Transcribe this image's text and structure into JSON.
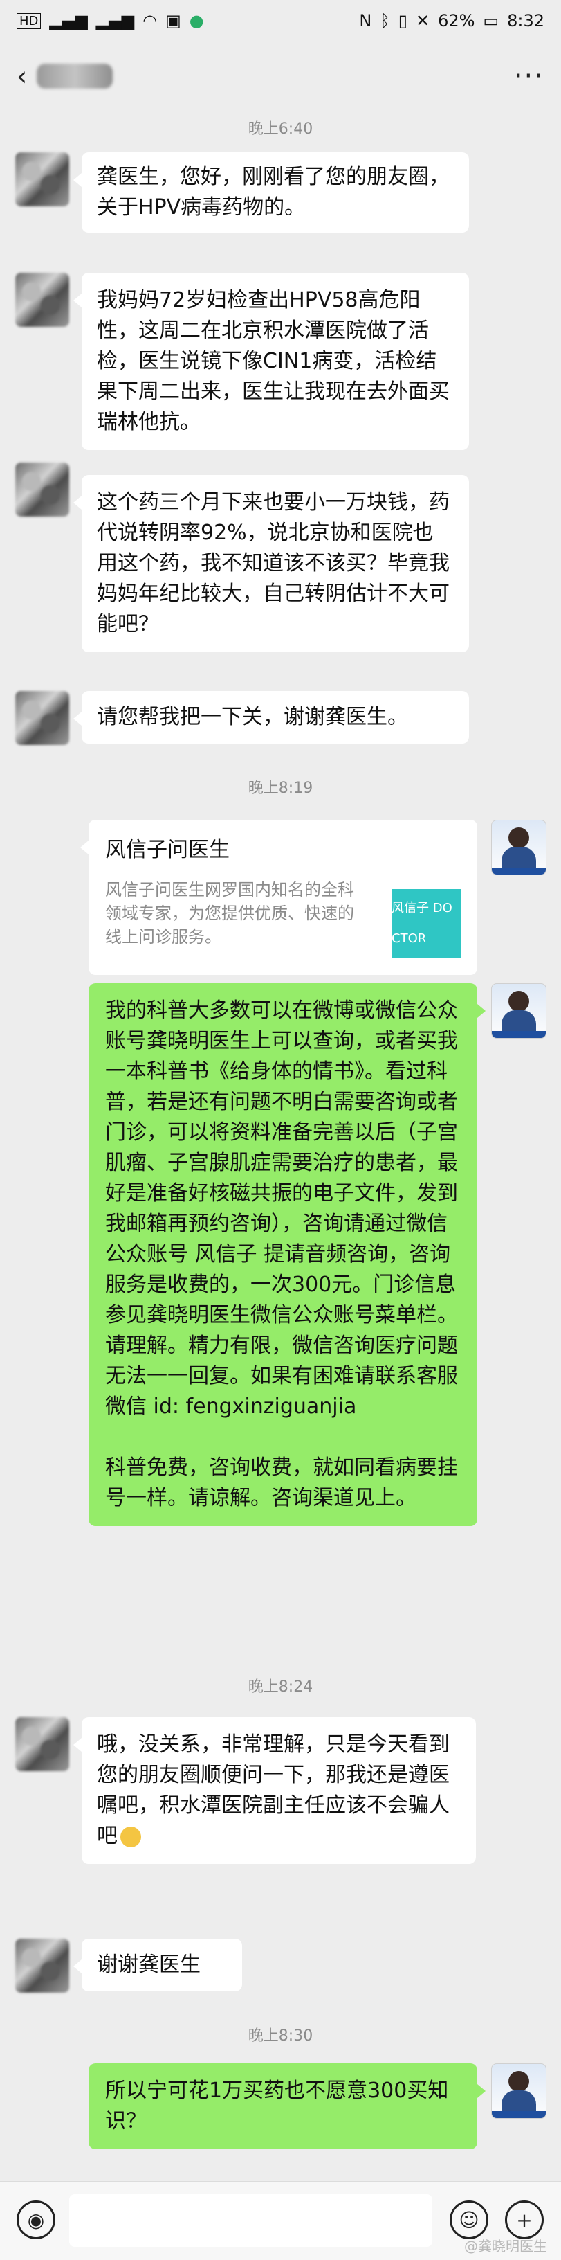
{
  "status_bar": {
    "left_icons": [
      "hd-icon",
      "signal-icon",
      "signal-icon",
      "wifi-icon",
      "notification-icon",
      "wechat-icon"
    ],
    "right_icons": [
      "nfc-icon",
      "bluetooth-icon",
      "vibrate-icon",
      "mute-icon"
    ],
    "battery": "62%",
    "time": "8:32"
  },
  "nav": {
    "back_glyph": "‹",
    "more_glyph": "···"
  },
  "timestamps": {
    "t1": "晚上6:40",
    "t2": "晚上8:19",
    "t3": "晚上8:24",
    "t4": "晚上8:30"
  },
  "messages": {
    "m1": "龚医生，您好，刚刚看了您的朋友圈，关于HPV病毒药物的。",
    "m2": "我妈妈72岁妇检查出HPV58高危阳性，这周二在北京积水潭医院做了活检，医生说镜下像CIN1病变，活检结果下周二出来，医生让我现在去外面买瑞林他抗。",
    "m3": "这个药三个月下来也要小一万块钱，药代说转阴率92%，说北京协和医院也用这个药，我不知道该不该买？毕竟我妈妈年纪比较大，自己转阴估计不大可能吧？",
    "m4": "请您帮我把一下关，谢谢龚医生。",
    "m6_p1": "我的科普大多数可以在微博或微信公众账号龚晓明医生上可以查询，或者买我一本科普书《给身体的情书》。看过科普，若是还有问题不明白需要咨询或者门诊，可以将资料准备完善以后（子宫肌瘤、子宫腺肌症需要治疗的患者，最好是准备好核磁共振的电子文件，发到我邮箱再预约咨询），咨询请通过微信公众账号 风信子 提请音频咨询，咨询服务是收费的，一次300元。门诊信息参见龚晓明医生微信公众账号菜单栏。请理解。精力有限，微信咨询医疗问题无法一一回复。如果有困难请联系客服微信 id: fengxinziguanjia",
    "m6_p2": "科普免费，咨询收费，就如同看病要挂号一样。请谅解。咨询渠道见上。",
    "m7": "哦，没关系，非常理解，只是今天看到您的朋友圈顺便问一下，那我还是遵医嘱吧，积水潭医院副主任应该不会骗人吧",
    "m8": "谢谢龚医生",
    "m9": "所以宁可花1万买药也不愿意300买知识？"
  },
  "card": {
    "title": "风信子问医生",
    "desc": "风信子问医生网罗国内知名的全科领域专家，为您提供优质、快速的线上问诊服务。",
    "logo_text": "风信子 DOCTOR"
  },
  "input_bar": {
    "voice_icon": "voice-icon",
    "emoji_icon": "emoji-icon",
    "plus_icon": "plus-icon"
  },
  "watermark": "@龚晓明医生",
  "colors": {
    "background": "#ededed",
    "bubble_left": "#ffffff",
    "bubble_right": "#95ec69",
    "time_text": "#8b8b8b"
  }
}
